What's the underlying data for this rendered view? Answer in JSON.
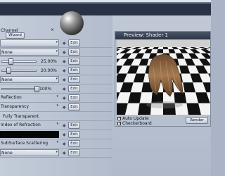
{
  "header": {
    "channel_label": "Channel",
    "wizard_label": "Wizard"
  },
  "rows": [
    {
      "label": "",
      "type": "value",
      "edit": "Edit"
    },
    {
      "label": "None",
      "type": "value",
      "edit": "Edit"
    },
    {
      "label": "",
      "type": "slider",
      "value_text": "25.00%",
      "value": 0.25,
      "edit": "Edit"
    },
    {
      "label": "",
      "type": "slider",
      "value_text": "20.00%",
      "value": 0.2,
      "edit": "Edit"
    },
    {
      "label": "None",
      "type": "value",
      "edit": "Edit"
    },
    {
      "label": "",
      "type": "slider",
      "value_text": "100%",
      "value": 1.0,
      "edit": "Edit"
    },
    {
      "label": "Reflection",
      "type": "value",
      "edit": "Edit"
    },
    {
      "label": "Transparency",
      "type": "value",
      "edit": "Edit"
    },
    {
      "label": "Fully Transparent",
      "type": "text"
    },
    {
      "label": "Index of Refraction",
      "type": "value",
      "edit": "Edit"
    },
    {
      "label": "",
      "type": "dark",
      "edit": "Edit"
    },
    {
      "label": "SubSurface Scattering",
      "type": "value",
      "edit": "Edit"
    },
    {
      "label": "None",
      "type": "value",
      "edit": "Edit"
    }
  ],
  "preview": {
    "title": "Preview: Shader 1",
    "auto_update_label": "Auto Update",
    "auto_update_checked": true,
    "checkerboard_label": "Checkerboard",
    "checkerboard_checked": true,
    "render_label": "Render"
  },
  "icons": [
    "close-icon",
    "dropdown-arrow-icon",
    "bullet-icon",
    "material-sphere-icon"
  ]
}
